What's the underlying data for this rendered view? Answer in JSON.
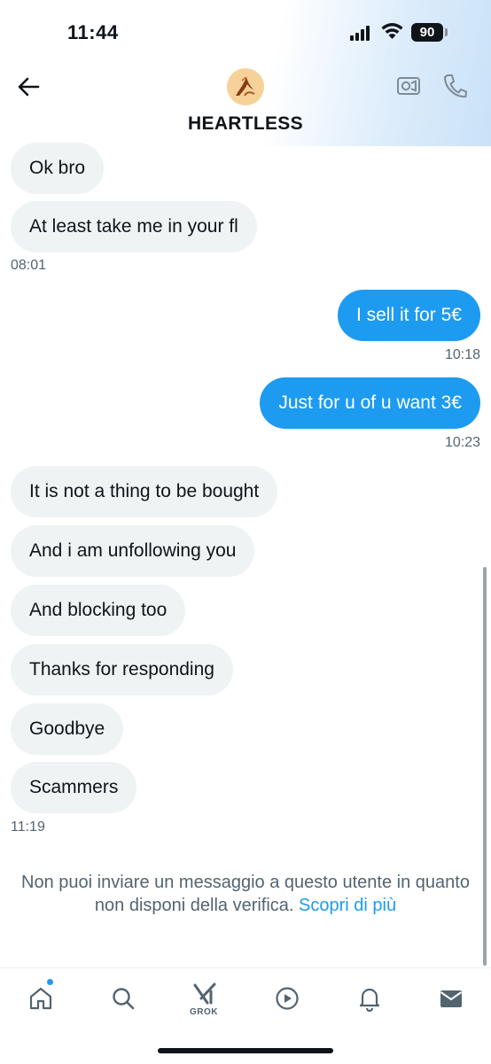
{
  "status_bar": {
    "time": "11:44",
    "battery": "90"
  },
  "header": {
    "name": "HEARTLESS"
  },
  "messages": [
    {
      "text": "Ok bro"
    },
    {
      "text": "At least take me in your fl"
    },
    {
      "time": "08:01"
    },
    {
      "text": "I sell it for 5€"
    },
    {
      "time": "10:18"
    },
    {
      "text": "Just for u of u want 3€"
    },
    {
      "time": "10:23"
    },
    {
      "text": "It is not a thing to be bought"
    },
    {
      "text": "And i am unfollowing you"
    },
    {
      "text": "And blocking too"
    },
    {
      "text": "Thanks for responding"
    },
    {
      "text": "Goodbye"
    },
    {
      "text": "Scammers"
    },
    {
      "time": "11:19"
    }
  ],
  "notice": {
    "text": "Non puoi inviare un messaggio a questo utente in quanto non disponi della verifica.",
    "link": "Scopri di più"
  },
  "tabs": {
    "grok_label": "GROK"
  },
  "colors": {
    "accent": "#1d9bf0",
    "incoming_bubble": "#eff3f4",
    "text": "#0f1419",
    "muted": "#536471"
  },
  "icons": [
    "back-arrow-icon",
    "video-camera-icon",
    "phone-icon",
    "home-icon",
    "search-icon",
    "grok-icon",
    "play-icon",
    "bell-icon",
    "mail-icon"
  ]
}
